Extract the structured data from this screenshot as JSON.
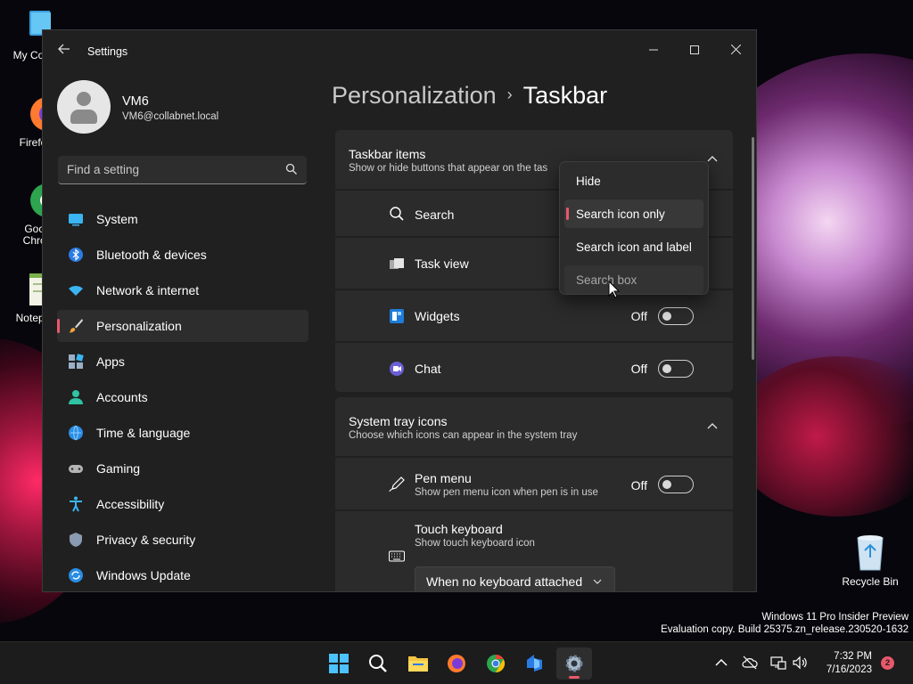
{
  "desktop": {
    "icons": [
      {
        "label": "My Com",
        "icon": "computer-icon"
      },
      {
        "label": "Firefo",
        "icon": "firefox-icon"
      },
      {
        "label": "Goog Chron",
        "icon": "chrome-icon"
      },
      {
        "label": "Notepa",
        "icon": "notepad-icon"
      }
    ],
    "recycle_bin": "Recycle Bin",
    "watermark_line1": "Windows 11 Pro Insider Preview",
    "watermark_line2": "Evaluation copy. Build 25375.zn_release.230520-1632"
  },
  "window": {
    "title": "Settings",
    "controls": {
      "minimize": "—",
      "maximize": "☐",
      "close": "✕"
    }
  },
  "profile": {
    "name": "VM6",
    "email": "VM6@collabnet.local"
  },
  "search": {
    "placeholder": "Find a setting"
  },
  "nav": {
    "items": [
      {
        "label": "System",
        "icon": "system-icon",
        "active": false
      },
      {
        "label": "Bluetooth & devices",
        "icon": "bluetooth-icon",
        "active": false
      },
      {
        "label": "Network & internet",
        "icon": "wifi-icon",
        "active": false
      },
      {
        "label": "Personalization",
        "icon": "brush-icon",
        "active": true
      },
      {
        "label": "Apps",
        "icon": "apps-icon",
        "active": false
      },
      {
        "label": "Accounts",
        "icon": "accounts-icon",
        "active": false
      },
      {
        "label": "Time & language",
        "icon": "globe-icon",
        "active": false
      },
      {
        "label": "Gaming",
        "icon": "gamepad-icon",
        "active": false
      },
      {
        "label": "Accessibility",
        "icon": "accessibility-icon",
        "active": false
      },
      {
        "label": "Privacy & security",
        "icon": "shield-icon",
        "active": false
      },
      {
        "label": "Windows Update",
        "icon": "update-icon",
        "active": false
      }
    ]
  },
  "breadcrumb": {
    "parent": "Personalization",
    "separator": "›",
    "current": "Taskbar"
  },
  "taskbar_items": {
    "title": "Taskbar items",
    "subtitle": "Show or hide buttons that appear on the tas",
    "rows": [
      {
        "label": "Search",
        "icon": "search-icon"
      },
      {
        "label": "Task view",
        "icon": "task-view-icon"
      },
      {
        "label": "Widgets",
        "icon": "widgets-icon",
        "state": "Off"
      },
      {
        "label": "Chat",
        "icon": "chat-icon",
        "state": "Off"
      }
    ]
  },
  "system_tray": {
    "title": "System tray icons",
    "subtitle": "Choose which icons can appear in the system tray",
    "pen_menu": {
      "label": "Pen menu",
      "desc": "Show pen menu icon when pen is in use",
      "state": "Off"
    },
    "touch_keyboard": {
      "label": "Touch keyboard",
      "desc": "Show touch keyboard icon",
      "value": "When no keyboard attached"
    }
  },
  "search_menu": {
    "options": [
      "Hide",
      "Search icon only",
      "Search icon and label",
      "Search box"
    ],
    "selected": "Search icon only"
  },
  "taskbar": {
    "apps": [
      "start-icon",
      "search-icon",
      "file-explorer-icon",
      "firefox-icon",
      "chrome-icon",
      "azure-devops-icon",
      "settings-icon"
    ],
    "time": "7:32 PM",
    "date": "7/16/2023",
    "notifications": "2"
  },
  "colors": {
    "accent": "#e8586b",
    "window_bg": "#202020",
    "card_bg": "#2b2b2b"
  }
}
